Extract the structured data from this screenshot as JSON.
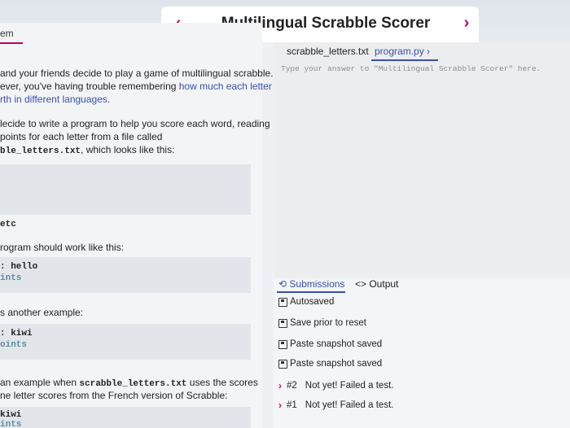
{
  "header": {
    "title": "Multilingual Scrabble Scorer",
    "prev_glyph": "‹",
    "next_glyph": "›"
  },
  "left": {
    "tab_label": "em",
    "intro": {
      "line1": "and your friends decide to play a game of multilingual scrabble.",
      "line2_pre": "ever, you've having trouble remembering ",
      "line2_link": "how much each letter",
      "line3_link": "rth in different languages."
    },
    "decide": {
      "line1": "lecide to write a program to help you score each word, reading",
      "line2": " points for each letter from a file called",
      "line3_code": "ble_letters.txt",
      "line3_post": ", which looks like this:"
    },
    "etc": "etc",
    "work_like": "rogram should work like this:",
    "example1": {
      "line1": ": hello",
      "line2": "ints"
    },
    "another": "s another example:",
    "example2": {
      "line1": ": kiwi",
      "line2": "oints"
    },
    "french": {
      "line1_pre": "an example when ",
      "line1_code": "scrabble_letters.txt",
      "line1_post": " uses the scores",
      "line2": "ne letter scores from the French version of Scrabble:"
    },
    "example3": {
      "line1": "kiwi",
      "line2": "ints"
    }
  },
  "editor": {
    "tabs": [
      "scrabble_letters.txt",
      "program.py ›"
    ],
    "hint": "Type your answer to \"Multilingual Scrabble Scorer\" here."
  },
  "panel": {
    "tabs": [
      "⟲ Submissions",
      "<> Output"
    ],
    "items": [
      {
        "label": "Autosaved"
      },
      {
        "label": "Save prior to reset"
      },
      {
        "label": "Paste snapshot saved"
      },
      {
        "label": "Paste snapshot saved"
      }
    ],
    "attempts": [
      {
        "num": "#2",
        "status": "Not yet! Failed a test."
      },
      {
        "num": "#1",
        "status": "Not yet! Failed a test."
      }
    ]
  },
  "colors": {
    "accent": "#c0005a",
    "link": "#3a4fb0"
  }
}
